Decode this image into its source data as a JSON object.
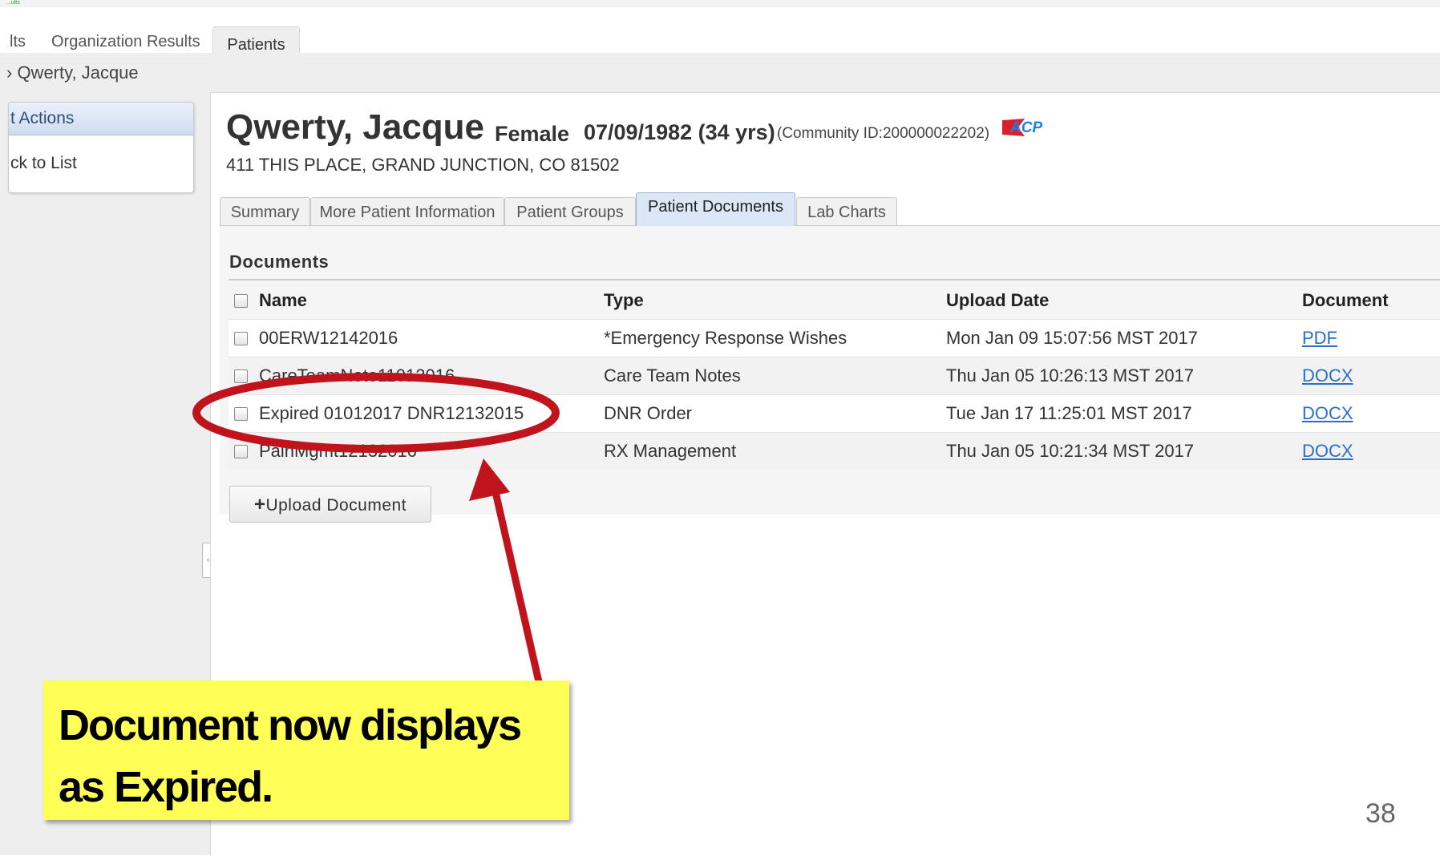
{
  "top_nav": {
    "partial_fragment": "...ults",
    "items": [
      "lts",
      "Organization Results"
    ],
    "active": "Patients"
  },
  "breadcrumb": "› Qwerty, Jacque",
  "sidebar": {
    "header": "t Actions",
    "back_link": "ck to List"
  },
  "patient": {
    "name": "Qwerty, Jacque",
    "sex": "Female",
    "dob": "07/09/1982 (34 yrs)",
    "community": "(Community ID:200000022202)",
    "flag_label": "ACP",
    "address": "411 THIS PLACE, GRAND JUNCTION, CO 81502"
  },
  "tabs": [
    "Summary",
    "More Patient Information",
    "Patient Groups",
    "Patient Documents",
    "Lab Charts"
  ],
  "active_tab": "Patient Documents",
  "documents": {
    "title": "Documents",
    "columns": [
      "Name",
      "Type",
      "Upload Date",
      "Document"
    ],
    "rows": [
      {
        "name": "00ERW12142016",
        "type": "*Emergency Response Wishes",
        "date": "Mon Jan 09 15:07:56 MST 2017",
        "doc": "PDF"
      },
      {
        "name": "CareTeamNote11012016",
        "type": "Care Team Notes",
        "date": "Thu Jan 05 10:26:13 MST 2017",
        "doc": "DOCX"
      },
      {
        "name": "Expired 01012017 DNR12132015",
        "type": "DNR Order",
        "date": "Tue Jan 17 11:25:01 MST 2017",
        "doc": "DOCX"
      },
      {
        "name": "PainMgmt12132016",
        "type": "RX Management",
        "date": "Thu Jan 05 10:21:34 MST 2017",
        "doc": "DOCX"
      }
    ],
    "upload_button": "Upload Document"
  },
  "annotation": {
    "line1": "Document now displays",
    "line2": "as Expired.",
    "accent_color": "#c0141c",
    "callout_color": "#ffff57"
  },
  "page_number": "38"
}
